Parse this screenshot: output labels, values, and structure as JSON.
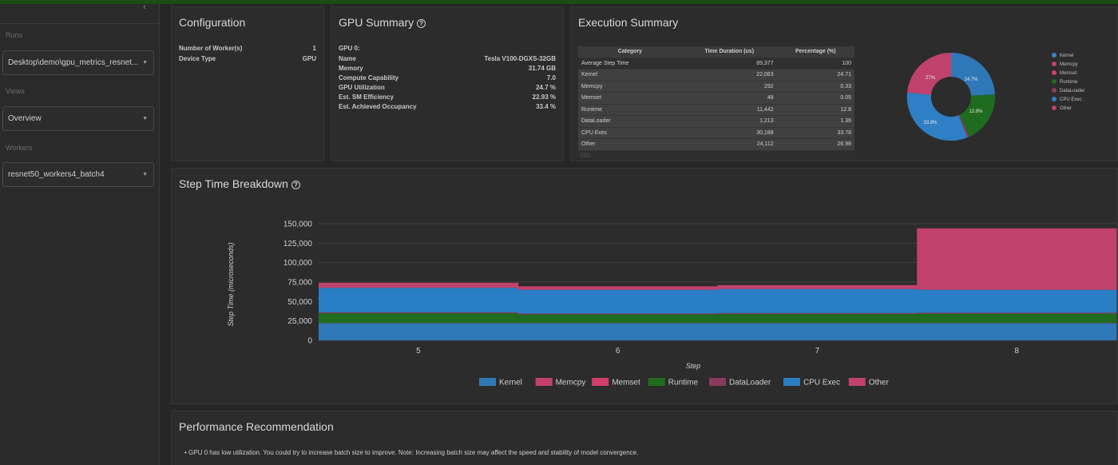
{
  "sidebar": {
    "collapse_glyph": "‹",
    "runs_label": "Runs",
    "run_value": "Desktop\\demo\\gpu_metrics_resnet...",
    "views_label": "Views",
    "view_value": "Overview",
    "workers_label": "Workers",
    "worker_value": "resnet50_workers4_batch4"
  },
  "configuration": {
    "title": "Configuration",
    "rows": [
      {
        "key": "Number of Worker(s)",
        "value": "1"
      },
      {
        "key": "Device Type",
        "value": "GPU"
      }
    ]
  },
  "gpu_summary": {
    "title": "GPU Summary",
    "help_glyph": "?",
    "header": "GPU 0:",
    "rows": [
      {
        "key": "Name",
        "value": "Tesla V100-DGXS-32GB"
      },
      {
        "key": "Memory",
        "value": "31.74 GB"
      },
      {
        "key": "Compute Capability",
        "value": "7.0"
      },
      {
        "key": "GPU Utilization",
        "value": "24.7 %"
      },
      {
        "key": "Est. SM Efficiency",
        "value": "22.93 %"
      },
      {
        "key": "Est. Achieved Occupancy",
        "value": "33.4 %"
      }
    ]
  },
  "execution_summary": {
    "title": "Execution Summary",
    "columns": [
      "Category",
      "Time Duration (us)",
      "Percentage (%)"
    ],
    "rows": [
      {
        "category": "Average Step Time",
        "duration": "89,377",
        "percent": "100"
      },
      {
        "category": "Kernel",
        "duration": "22,083",
        "percent": "24.71"
      },
      {
        "category": "Memcpy",
        "duration": "292",
        "percent": "0.33"
      },
      {
        "category": "Memset",
        "duration": "48",
        "percent": "0.05"
      },
      {
        "category": "Runtime",
        "duration": "11,442",
        "percent": "12.8"
      },
      {
        "category": "DataLoader",
        "duration": "1,213",
        "percent": "1.36"
      },
      {
        "category": "CPU Exec",
        "duration": "30,188",
        "percent": "33.78"
      },
      {
        "category": "Other",
        "duration": "24,112",
        "percent": "26.98"
      }
    ],
    "pie_labels": {
      "kernel": "24.7%",
      "runtime": "12.8%",
      "cpu_exec": "33.8%",
      "other": "27%"
    },
    "legend": [
      {
        "name": "Kernel",
        "color": "#3d85c6"
      },
      {
        "name": "Memcpy",
        "color": "#c0426c"
      },
      {
        "name": "Memset",
        "color": "#d13f6a"
      },
      {
        "name": "Runtime",
        "color": "#1d6b1d"
      },
      {
        "name": "DataLoader",
        "color": "#8a3a5c"
      },
      {
        "name": "CPU Exec",
        "color": "#2e7fc4"
      },
      {
        "name": "Other",
        "color": "#c0426c"
      }
    ]
  },
  "step_time": {
    "title": "Step Time Breakdown",
    "help_glyph": "?",
    "y_ticks": [
      "150,000",
      "125,000",
      "100,000",
      "75,000",
      "50,000",
      "25,000",
      "0"
    ],
    "x_ticks": [
      "5",
      "6",
      "7",
      "8"
    ],
    "xlabel": "Step",
    "ylabel": "Step Time (microseconds)"
  },
  "chart_data": {
    "type": "area",
    "title": "Step Time Breakdown",
    "xlabel": "Step",
    "ylabel": "Step Time (microseconds)",
    "ylim": [
      0,
      150000
    ],
    "grid": true,
    "legend_position": "bottom",
    "x": [
      5,
      6,
      7,
      8
    ],
    "series": [
      {
        "name": "Kernel",
        "color": "#2f78b8",
        "values": [
          22000,
          22000,
          22000,
          22000
        ]
      },
      {
        "name": "Memcpy",
        "color": "#c0426c",
        "values": [
          300,
          300,
          300,
          300
        ]
      },
      {
        "name": "Memset",
        "color": "#d13f6a",
        "values": [
          50,
          50,
          50,
          50
        ]
      },
      {
        "name": "Runtime",
        "color": "#1f6b1f",
        "values": [
          12500,
          11000,
          11500,
          12000
        ]
      },
      {
        "name": "DataLoader",
        "color": "#8a3a5c",
        "values": [
          1200,
          1200,
          1200,
          1200
        ]
      },
      {
        "name": "CPU Exec",
        "color": "#2a7ec6",
        "values": [
          31500,
          30500,
          31000,
          29500
        ]
      },
      {
        "name": "Other",
        "color": "#c0426c",
        "values": [
          6500,
          4500,
          5000,
          79000
        ]
      }
    ]
  },
  "performance": {
    "title": "Performance Recommendation",
    "bullet": "•",
    "text": "GPU 0 has low utilization. You could try to increase batch size to improve. Note: Increasing batch size may affect the speed and stability of model convergence."
  }
}
